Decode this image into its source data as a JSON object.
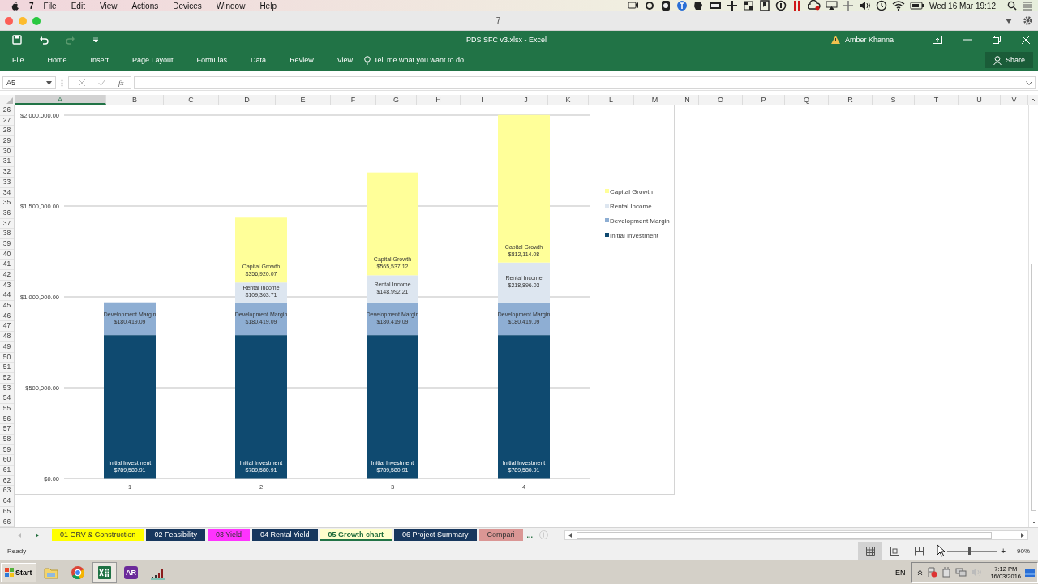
{
  "menu_bar": {
    "app": "7",
    "items": [
      "File",
      "Edit",
      "View",
      "Actions",
      "Devices",
      "Window",
      "Help"
    ],
    "clock": "Wed 16 Mar  19:12"
  },
  "window": {
    "caption": "7",
    "title": "PDS SFC v3.xlsx - Excel",
    "user": "Amber Khanna"
  },
  "ribbon_tabs": [
    {
      "label": "File",
      "selected": false
    },
    {
      "label": "Home",
      "selected": false
    },
    {
      "label": "Insert",
      "selected": false
    },
    {
      "label": "Page Layout",
      "selected": false
    },
    {
      "label": "Formulas",
      "selected": false
    },
    {
      "label": "Data",
      "selected": false
    },
    {
      "label": "Review",
      "selected": false
    },
    {
      "label": "View",
      "selected": false
    }
  ],
  "tell_me": "Tell me what you want to do",
  "share": "Share",
  "formula_bar": {
    "name_box": "A5",
    "fx": "fx"
  },
  "columns": [
    {
      "label": "A",
      "selected": true
    },
    {
      "label": "B",
      "selected": false
    },
    {
      "label": "C",
      "selected": false
    },
    {
      "label": "D",
      "selected": false
    },
    {
      "label": "E",
      "selected": false
    },
    {
      "label": "F",
      "selected": false
    },
    {
      "label": "G",
      "selected": false
    },
    {
      "label": "H",
      "selected": false
    },
    {
      "label": "I",
      "selected": false
    },
    {
      "label": "J",
      "selected": false
    },
    {
      "label": "K",
      "selected": false
    },
    {
      "label": "L",
      "selected": false
    },
    {
      "label": "M",
      "selected": false
    },
    {
      "label": "N",
      "selected": false
    },
    {
      "label": "O",
      "selected": false
    },
    {
      "label": "P",
      "selected": false
    },
    {
      "label": "Q",
      "selected": false
    },
    {
      "label": "R",
      "selected": false
    },
    {
      "label": "S",
      "selected": false
    },
    {
      "label": "T",
      "selected": false
    },
    {
      "label": "U",
      "selected": false
    },
    {
      "label": "V",
      "selected": false
    }
  ],
  "rows": [
    "26",
    "27",
    "28",
    "29",
    "30",
    "31",
    "32",
    "33",
    "34",
    "35",
    "36",
    "37",
    "38",
    "39",
    "40",
    "41",
    "42",
    "43",
    "44",
    "45",
    "46",
    "47",
    "48",
    "49",
    "50",
    "51",
    "52",
    "53",
    "54",
    "55",
    "56",
    "57",
    "58",
    "59",
    "60",
    "61",
    "62",
    "63",
    "64",
    "65",
    "66"
  ],
  "chart": {
    "chart_data": {
      "type": "bar",
      "stacked": true,
      "orientation": "vertical",
      "grid": true,
      "legend": true,
      "categories": [
        "1",
        "2",
        "3",
        "4"
      ],
      "ylim": [
        0,
        2000000
      ],
      "yticks": [
        {
          "value": 0,
          "label": "$0.00"
        },
        {
          "value": 500000,
          "label": "$500,000.00"
        },
        {
          "value": 1000000,
          "label": "$1,000,000.00"
        },
        {
          "value": 1500000,
          "label": "$1,500,000.00"
        },
        {
          "value": 2000000,
          "label": "$2,000,000.00"
        }
      ],
      "series": [
        {
          "name": "Initial Investment",
          "color": "#0f4a70",
          "values": [
            789580.91,
            789580.91,
            789580.91,
            789580.91
          ],
          "value_labels": [
            [
              "Initial Investment",
              "$789,580.91"
            ],
            [
              "Initial Investment",
              "$789,580.91"
            ],
            [
              "Initial Investment",
              "$789,580.91"
            ],
            [
              "Initial Investment",
              "$789,580.91"
            ]
          ]
        },
        {
          "name": "Development Margin",
          "color": "#8eaed3",
          "values": [
            180419.09,
            180419.09,
            180419.09,
            180419.09
          ],
          "value_labels": [
            [
              "Development Margin",
              "$180,419.09"
            ],
            [
              "Development Margin",
              "$180,419.09"
            ],
            [
              "Development Margin",
              "$180,419.09"
            ],
            [
              "Development Margin",
              "$180,419.09"
            ]
          ]
        },
        {
          "name": "Rental Income",
          "color": "#dde6f0",
          "values": [
            0,
            109363.71,
            148992.21,
            218896.03
          ],
          "value_labels": [
            null,
            [
              "Rental Income",
              "$109,363.71"
            ],
            [
              "Rental Income",
              "$148,992.21"
            ],
            [
              "Rental Income",
              "$218,896.03"
            ]
          ]
        },
        {
          "name": "Capital Growth",
          "color": "#ffff99",
          "values": [
            0,
            356920.07,
            565537.12,
            812114.08
          ],
          "value_labels": [
            null,
            [
              "Capital Growth",
              "$356,920.07"
            ],
            [
              "Capital Growth",
              "$565,537.12"
            ],
            [
              "Capital Growth",
              "$812,114.08"
            ]
          ]
        }
      ]
    }
  },
  "sheet_tabs": [
    {
      "label": "01 GRV & Construction",
      "color": "#ffff00",
      "selected": false
    },
    {
      "label": "02 Feasibility",
      "color": "#17375e",
      "selected": false
    },
    {
      "label": "03 Yield",
      "color": "#ff33ff",
      "selected": false
    },
    {
      "label": "04 Rental Yield",
      "color": "#17375e",
      "selected": false
    },
    {
      "label": "05 Growth chart",
      "color": "#ffffcc",
      "selected": true
    },
    {
      "label": "06 Project Summary",
      "color": "#17375e",
      "selected": false
    },
    {
      "label": "Compari",
      "color": "#da9694",
      "selected": false
    }
  ],
  "more_tabs": "...",
  "status_bar": {
    "text": "Ready",
    "zoom_plus": "+",
    "zoom": "90%",
    "zoom_level": {
      "level": 0.42
    }
  },
  "taskbar": {
    "start": "Start",
    "app_badge": "AR",
    "language": "EN",
    "time": "7:12 PM",
    "date": "16/03/2016"
  }
}
